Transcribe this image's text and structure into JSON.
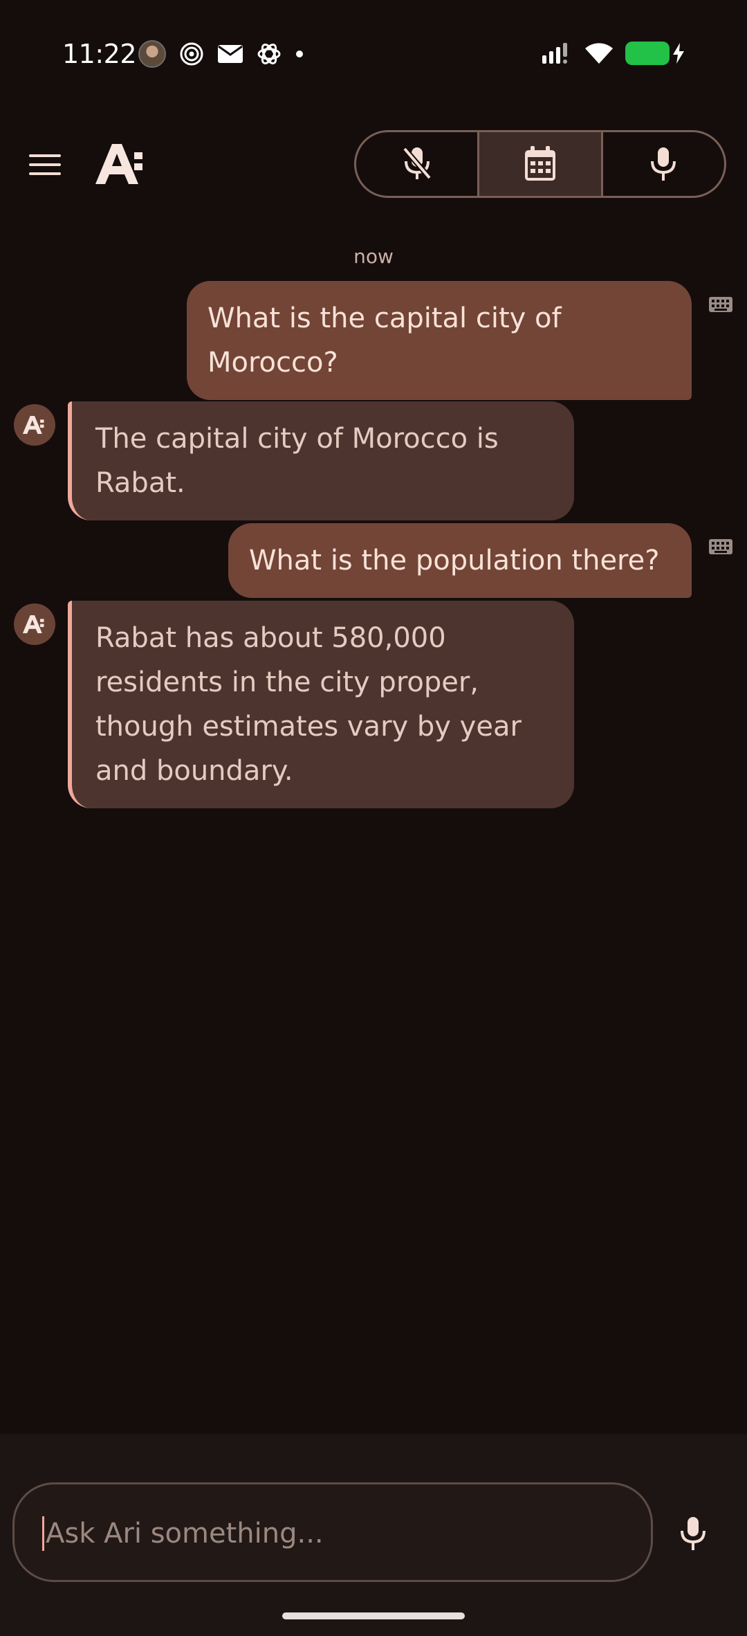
{
  "status_bar": {
    "time": "11:22",
    "left_icons": [
      "avatar-notification",
      "spiral-icon",
      "mail-icon",
      "openai-icon",
      "dot-icon"
    ],
    "right_icons": [
      "signal-icon",
      "wifi-icon",
      "battery-charging-icon"
    ],
    "battery_color": "#22c147"
  },
  "header": {
    "menu_icon": "hamburger-menu-icon",
    "logo_icon": "ari-logo-icon",
    "modes": [
      {
        "name": "mic-off",
        "icon": "mic-off-icon",
        "active": false
      },
      {
        "name": "calendar",
        "icon": "calendar-icon",
        "active": true
      },
      {
        "name": "mic",
        "icon": "mic-icon",
        "active": false
      }
    ]
  },
  "chat": {
    "timestamp": "now",
    "messages": [
      {
        "role": "user",
        "text": "What is the capital city of Morocco?",
        "icon": "keyboard-icon"
      },
      {
        "role": "assistant",
        "text": "The capital city of Morocco is Rabat."
      },
      {
        "role": "user",
        "text": "What is the population there?",
        "icon": "keyboard-icon"
      },
      {
        "role": "assistant",
        "text": "Rabat has about 580,000 residents in the city proper, though estimates vary by year and boundary."
      }
    ]
  },
  "input": {
    "placeholder": "Ask Ari something...",
    "mic_icon": "mic-icon"
  },
  "colors": {
    "background": "#140d0c",
    "user_bubble": "#734537",
    "assistant_bubble": "#4e342e",
    "accent": "#f1a89a",
    "text": "#f3ddd4"
  }
}
